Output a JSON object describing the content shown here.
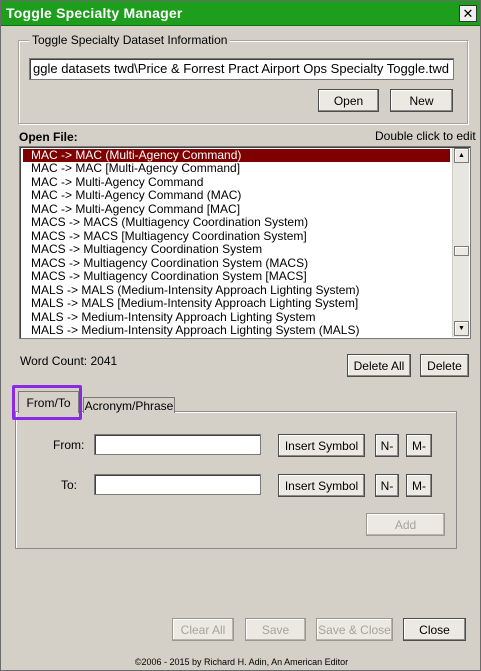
{
  "window": {
    "title": "Toggle Specialty Manager",
    "close_glyph": "✕"
  },
  "dataset_info": {
    "legend": "Toggle Specialty Dataset Information",
    "path": "ggle datasets twd\\Price & Forrest Pract Airport Ops Specialty Toggle.twd",
    "open_label": "Open",
    "new_label": "New"
  },
  "open_file": {
    "label": "Open File:",
    "hint": "Double click to edit",
    "items": [
      "MAC -> MAC (Multi-Agency Command)",
      "MAC -> MAC [Multi-Agency Command]",
      "MAC -> Multi-Agency Command",
      "MAC -> Multi-Agency Command (MAC)",
      "MAC -> Multi-Agency Command [MAC]",
      "MACS -> MACS (Multiagency Coordination System)",
      "MACS -> MACS [Multiagency Coordination System]",
      "MACS -> Multiagency Coordination System",
      "MACS -> Multiagency Coordination System (MACS)",
      "MACS -> Multiagency Coordination System [MACS]",
      "MALS -> MALS (Medium-Intensity Approach Lighting System)",
      "MALS -> MALS [Medium-Intensity Approach Lighting System]",
      "MALS -> Medium-Intensity Approach Lighting System",
      "MALS -> Medium-Intensity Approach Lighting System (MALS)"
    ],
    "selected_index": 0,
    "scroll_up": "▲",
    "scroll_down": "▼"
  },
  "word_count": {
    "label": "Word Count: 2041"
  },
  "list_actions": {
    "delete_all_label": "Delete All",
    "delete_label": "Delete"
  },
  "tabs": {
    "from_to": "From/To",
    "acronym_phrase": "Acronym/Phrase"
  },
  "from_to": {
    "from_label": "From:",
    "to_label": "To:",
    "from_value": "",
    "to_value": "",
    "insert_symbol_label": "Insert Symbol",
    "n_dash_label": "N-",
    "m_dash_label": "M-",
    "add_label": "Add"
  },
  "footer": {
    "clear_all_label": "Clear All",
    "save_label": "Save",
    "save_close_label": "Save & Close",
    "close_label": "Close",
    "copyright": "©2006 - 2015 by Richard H. Adin, An American Editor"
  },
  "colors": {
    "titlebar": "#1d9e1d",
    "selection": "#7e0000",
    "tab_highlight": "#8a2be2"
  }
}
